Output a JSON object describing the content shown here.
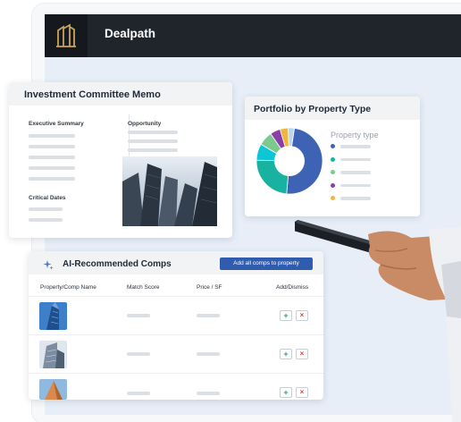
{
  "app": {
    "name": "Dealpath"
  },
  "memo": {
    "title": "Investment Committee Memo",
    "sections": {
      "executive_summary": "Executive Summary",
      "opportunity": "Opportunity",
      "critical_dates": "Critical Dates"
    }
  },
  "portfolio": {
    "title": "Portfolio by Property Type",
    "legend_title": "Property type",
    "chart_data": {
      "type": "pie",
      "categories": [
        "",
        "",
        "",
        "",
        "",
        "",
        ""
      ],
      "values": [
        49,
        24,
        8,
        7,
        5,
        4,
        3
      ],
      "colors": [
        "#3e63b5",
        "#17b3a0",
        "#0ec5d6",
        "#7bc98f",
        "#8b3fa6",
        "#f2b63c",
        "#b7d7ef"
      ]
    },
    "legend_colors": [
      "#3e63b5",
      "#17b3a0",
      "#7bc98f",
      "#8b3fa6",
      "#f2b63c"
    ]
  },
  "comps": {
    "title": "AI-Recommended Comps",
    "add_all_label": "Add all comps to property",
    "columns": [
      "Property/Comp Name",
      "Match Score",
      "Price / SF",
      "Add/Dismiss"
    ],
    "rows": [
      {
        "add": "+",
        "dismiss": "×"
      },
      {
        "add": "+",
        "dismiss": "×"
      },
      {
        "add": "+",
        "dismiss": "×"
      }
    ]
  },
  "icons": [
    "dealpath-logo-icon",
    "sparkle-icon",
    "plus-icon",
    "close-icon"
  ]
}
